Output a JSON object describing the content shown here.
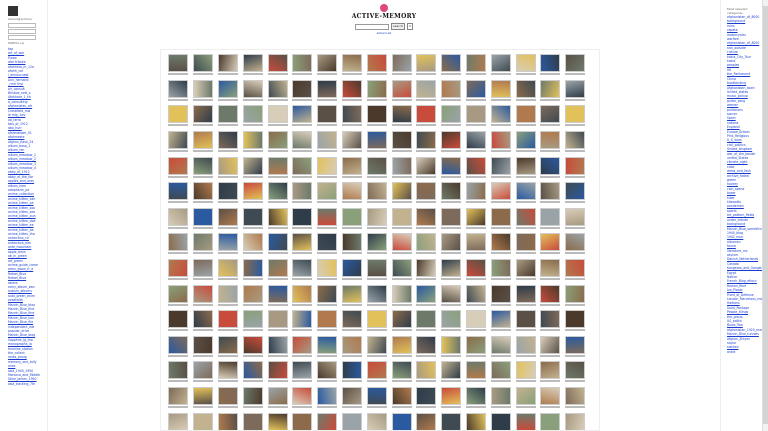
{
  "app": {
    "title": "ACTIVE-MEMORY"
  },
  "left": {
    "user_label": "wizard@archive",
    "portal_label": "PORTAL (s)",
    "links": [
      "top",
      "art_of_war",
      "Fixaw",
      "afar tribute",
      "afahhara_m_12a",
      "afahh_cor",
      "i_annoucuest",
      "Ann_hernand",
      "_rmrr thyr",
      "air_consult",
      "Bristow_nett_s",
      "Afahhara_1_kh",
      "a_consulting",
      "afghanistan_afr",
      "Crossfield_mw",
      "le mig_1wv",
      "ad_terra",
      "bbu_of_1912",
      "abo_hurr",
      "afshmeister_01",
      "afahmeste",
      "Afghan_flash_24",
      "album_boso_1",
      "album_ren",
      "album_meadow_1",
      "album_meadow_2",
      "album_meadow_3",
      "album_meadow_4",
      "abby_of_1912",
      "abby_of_the_libr",
      "apples_and_oran",
      "album_hem",
      "adapharm_pe",
      "anime_collection",
      "anime_kitten_aim",
      "anime_kitten_pe",
      "anime_kitten_soo",
      "anime_kitten_sea",
      "anime_kitten_pun",
      "anime_kitten_doe",
      "anime_kitten_ea",
      "anime_kitten_ba",
      "anime_kitten_tho",
      "antarctica_cir",
      "antarctica_aim",
      "ante_mountain",
      "apple_bmis",
      "ab_in_green",
      "art_green",
      "anime_guide_come",
      "army_gwon_fr_a",
      "Rafael_Blue",
      "Rafael_Blue",
      "asters",
      "army_album_ban",
      "auburn_albums",
      "auto_green_anim",
      "avsatwith",
      "Marvin_Blue_bloo",
      "Marvin_Blue_fine",
      "Marvin_Blue_fine",
      "Marvin_Blue_kon",
      "Marvin_Blue_file",
      "independent_isle",
      "popular_drive",
      "Marvin_Blue_blog",
      "Sapphire_Ig_tho",
      "monographs_la",
      "timeline_station",
      "the_collect",
      "roses_group",
      "memory_one_tally",
      "ones",
      "asia_1940_1950",
      "Morocco_and_Middle",
      "Stine_Jarken_1950",
      "asia_tracking_7th"
    ]
  },
  "header": {
    "search_placeholder": "",
    "search_button": "search",
    "close_label": "X",
    "sub_link": "advanced"
  },
  "grid": {
    "rows": 15,
    "cols": 17,
    "palette": [
      "#5a5046",
      "#8b6b4a",
      "#a89a82",
      "#3f4a52",
      "#6d7a6a",
      "#c2b28f",
      "#4b3a2c",
      "#9aa4a8",
      "#b07a4e",
      "#2f3c4a",
      "#d8cdb8",
      "#7e6a5a",
      "#c94b3b",
      "#2a5aa0",
      "#e2c15a",
      "#8aa07a"
    ]
  },
  "right": {
    "notes": [
      "Most relevant",
      "categories"
    ],
    "links": [
      "afghanistan_df_8000",
      "background",
      "ruins",
      "zapata",
      "motorcycles",
      "warfare",
      "afghanistan_df_8000",
      "nan_outside",
      "culture",
      "kabul_City_Tour",
      "kabul",
      "peoples",
      "UK",
      "the_Parliament",
      "China",
      "bookbinding",
      "Afghanistan_town",
      "United_states",
      "music_pickup",
      "guitar_song",
      "women",
      "politicians",
      "soccer",
      "Spain",
      "nations",
      "England",
      "Europe_Britain",
      "Pink_Religious",
      "U_S_wars",
      "civil_politics",
      "United_kingdom",
      "war_of_the_border",
      "united_States",
      "climate_sight",
      "color",
      "dress_and_fash",
      "archive_faded",
      "green",
      "hockey",
      "coin_spend",
      "boxer",
      "hiker",
      "kilowatts",
      "pandemics",
      "sports",
      "art_pattern_fields",
      "under_tribute",
      "background",
      "Marvin_Blue_something",
      "1940_blog",
      "1942_mun",
      "albumen",
      "fauna",
      "literature_ms",
      "asylum",
      "Danish_Netherlands",
      "Canada",
      "Kangaroo_and_Gangsters",
      "Egypt",
      "Native",
      "French_Blog_ethnic",
      "Roman_Blue",
      "Ivo_Plaatz",
      "Front_of_Defense",
      "London_Marvelous_mount",
      "Haitians",
      "Saint_Pantage",
      "People_tilings",
      "the_group",
      "US_politic",
      "Blues_Two",
      "afghanistan_1920_mas",
      "Marvin_Blue_tunnels",
      "Afghan_Zhiyev",
      "saylor",
      "slanted",
      "ankle"
    ]
  }
}
